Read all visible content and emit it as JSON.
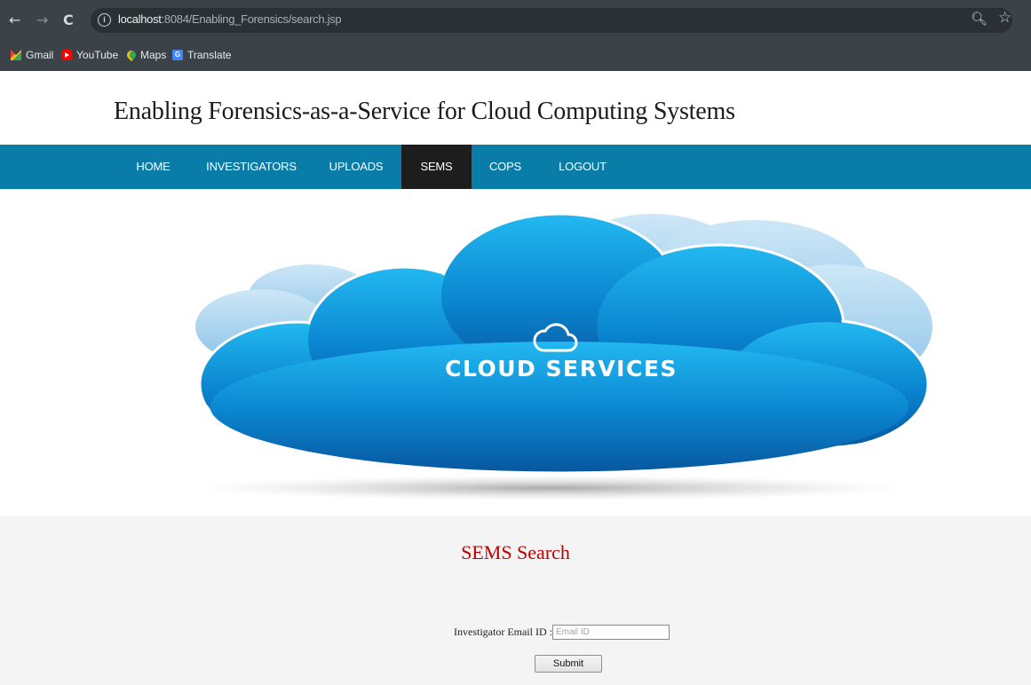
{
  "browser": {
    "url_host": "localhost",
    "url_rest": ":8084/Enabling_Forensics/search.jsp",
    "bookmarks": [
      {
        "label": "Gmail",
        "icon": "gmail-icon"
      },
      {
        "label": "YouTube",
        "icon": "youtube-icon"
      },
      {
        "label": "Maps",
        "icon": "maps-icon"
      },
      {
        "label": "Translate",
        "icon": "translate-icon"
      }
    ]
  },
  "site": {
    "title": "Enabling Forensics-as-a-Service for Cloud Computing Systems",
    "nav": [
      {
        "label": "HOME",
        "active": false
      },
      {
        "label": "INVESTIGATORS",
        "active": false
      },
      {
        "label": "UPLOADS",
        "active": false
      },
      {
        "label": "SEMS",
        "active": true
      },
      {
        "label": "COPS",
        "active": false
      },
      {
        "label": "LOGOUT",
        "active": false
      }
    ],
    "nav_color": "#0a7ca8",
    "nav_active_color": "#1d1d1d"
  },
  "banner": {
    "text": "CLOUD SERVICES",
    "icon": "cloud-outline-icon"
  },
  "search": {
    "title": "SEMS Search",
    "title_color": "#c00000",
    "field_label": "Investigator Email ID :",
    "field_placeholder": "Email ID",
    "field_value": "",
    "submit_label": "Submit"
  }
}
